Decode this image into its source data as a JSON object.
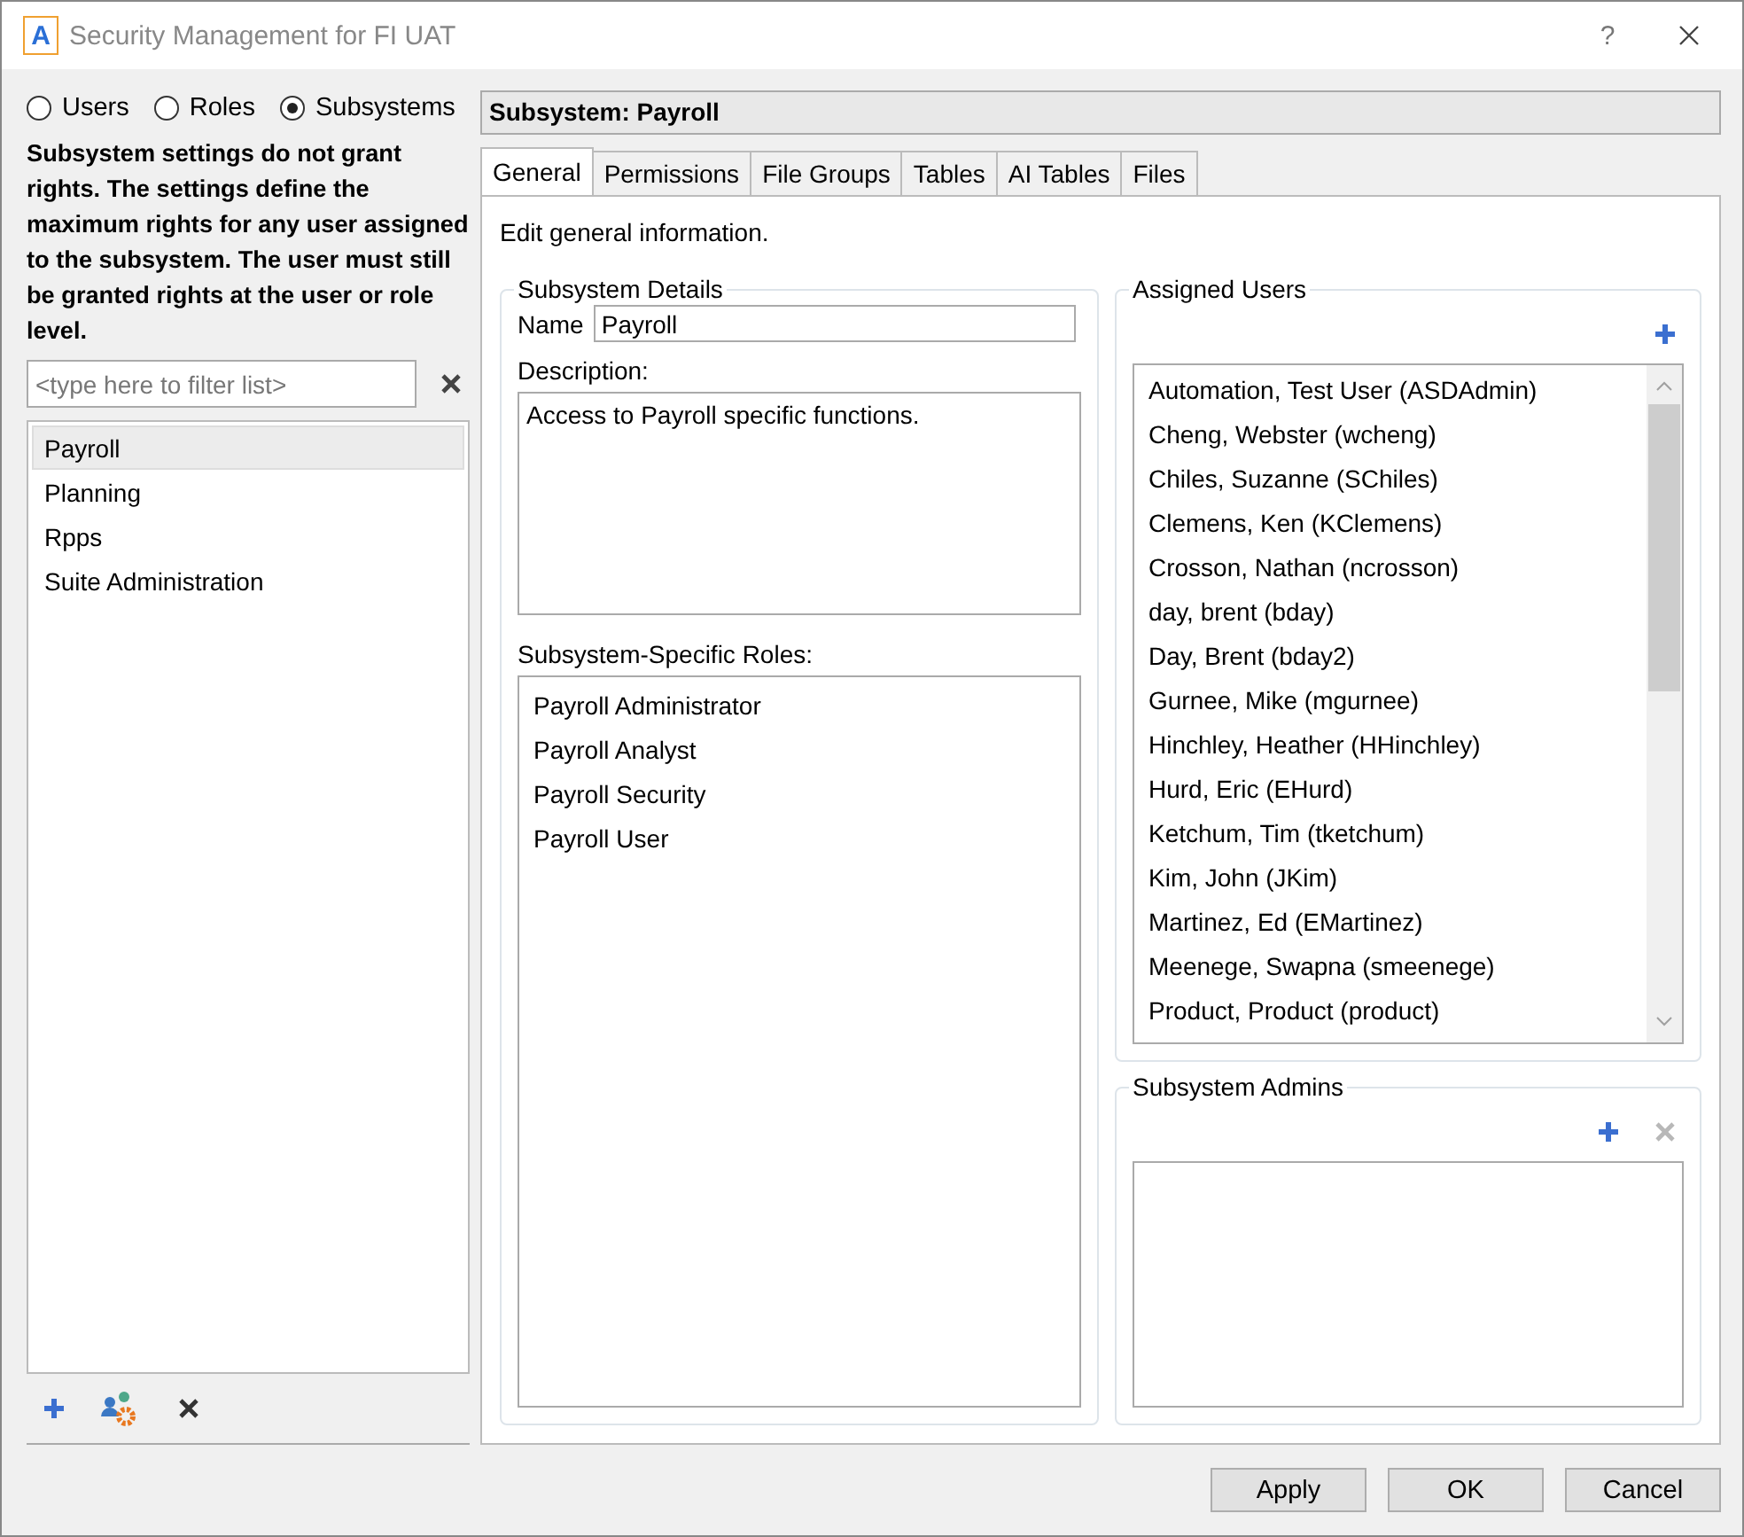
{
  "window": {
    "title": "Security Management for FI UAT",
    "app_letter": "A",
    "help": "?"
  },
  "modes": [
    {
      "label": "Users",
      "selected": false
    },
    {
      "label": "Roles",
      "selected": false
    },
    {
      "label": "Subsystems",
      "selected": true
    }
  ],
  "notice": "Subsystem settings do not grant rights. The settings define the maximum rights for any user assigned to the subsystem. The user must still be granted rights at the user or role level.",
  "filter": {
    "placeholder": "<type here to filter list>"
  },
  "subsystems": [
    {
      "label": "Payroll",
      "selected": true
    },
    {
      "label": "Planning",
      "selected": false
    },
    {
      "label": "Rpps",
      "selected": false
    },
    {
      "label": "Suite Administration",
      "selected": false
    }
  ],
  "header": "Subsystem: Payroll",
  "tabs": [
    {
      "label": "General",
      "selected": true
    },
    {
      "label": "Permissions",
      "selected": false
    },
    {
      "label": "File Groups",
      "selected": false
    },
    {
      "label": "Tables",
      "selected": false
    },
    {
      "label": "AI Tables",
      "selected": false
    },
    {
      "label": "Files",
      "selected": false
    }
  ],
  "intro": "Edit general information.",
  "details": {
    "legend": "Subsystem Details",
    "name_label": "Name",
    "name_value": "Payroll",
    "description_label": "Description:",
    "description_value": "Access to Payroll specific functions.",
    "roles_label": "Subsystem-Specific Roles:",
    "roles": [
      "Payroll Administrator",
      "Payroll Analyst",
      "Payroll Security",
      "Payroll User"
    ]
  },
  "assigned_users": {
    "legend": "Assigned Users",
    "users": [
      "Automation, Test User (ASDAdmin)",
      "Cheng, Webster (wcheng)",
      "Chiles, Suzanne (SChiles)",
      "Clemens, Ken (KClemens)",
      "Crosson, Nathan (ncrosson)",
      "day, brent (bday)",
      "Day, Brent (bday2)",
      "Gurnee, Mike (mgurnee)",
      "Hinchley, Heather (HHinchley)",
      "Hurd, Eric (EHurd)",
      "Ketchum, Tim (tketchum)",
      "Kim, John (JKim)",
      "Martinez, Ed (EMartinez)",
      "Meenege, Swapna (smeenege)",
      "Product, Product (product)"
    ]
  },
  "admins": {
    "legend": "Subsystem Admins",
    "remove_disabled": true
  },
  "buttons": [
    "Apply",
    "OK",
    "Cancel"
  ]
}
